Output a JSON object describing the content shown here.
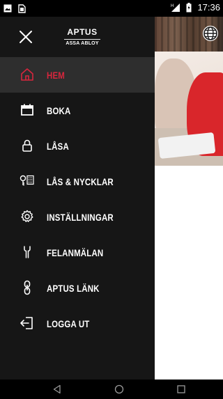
{
  "status_bar": {
    "time": "17:36",
    "left_icons": [
      "image-icon",
      "sim-icon"
    ],
    "right_icons": [
      "signal-icon",
      "battery-icon"
    ]
  },
  "drawer": {
    "logo": {
      "top": "APTUS",
      "bottom": "ASSA ABLOY"
    },
    "menu": [
      {
        "label": "HEM",
        "icon": "home-icon",
        "active": true
      },
      {
        "label": "BOKA",
        "icon": "calendar-icon",
        "active": false
      },
      {
        "label": "LÅSA",
        "icon": "lock-icon",
        "active": false
      },
      {
        "label": "LÅS & NYCKLAR",
        "icon": "keys-icon",
        "active": false
      },
      {
        "label": "INSTÄLLNINGAR",
        "icon": "gear-icon",
        "active": false
      },
      {
        "label": "FELANMÄLAN",
        "icon": "wrench-icon",
        "active": false
      },
      {
        "label": "APTUS LÄNK",
        "icon": "link-icon",
        "active": false
      },
      {
        "label": "LOGGA UT",
        "icon": "logout-icon",
        "active": false
      }
    ]
  },
  "colors": {
    "accent": "#d7263d",
    "drawer_bg": "#161616",
    "active_bg": "#2e2e2e"
  },
  "nav_bar": {
    "buttons": [
      "back-icon",
      "home-circle-icon",
      "recents-icon"
    ]
  }
}
